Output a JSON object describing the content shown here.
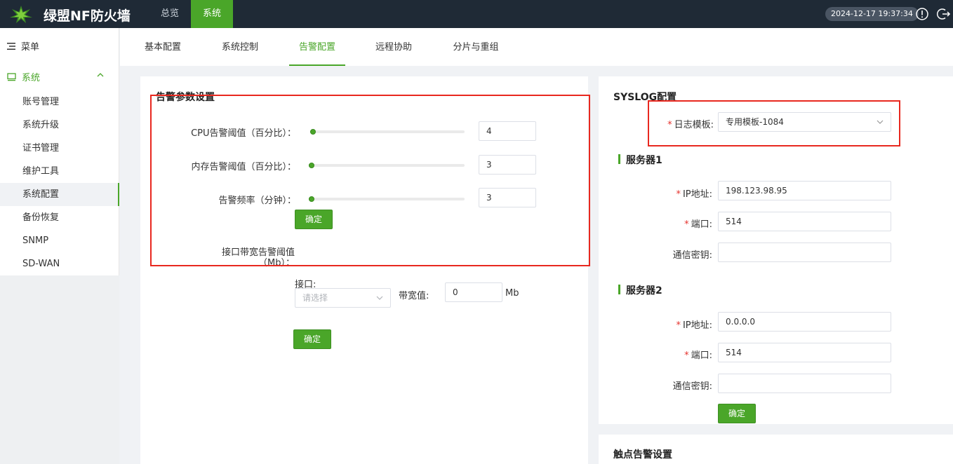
{
  "app": {
    "title": "绿盟NF防火墙",
    "nav": [
      {
        "label": "总览"
      },
      {
        "label": "系统"
      }
    ],
    "datetime": "2024-12-17 19:37:34"
  },
  "sidebar": {
    "menu_label": "菜单",
    "group_label": "系统",
    "items": [
      {
        "label": "账号管理"
      },
      {
        "label": "系统升级"
      },
      {
        "label": "证书管理"
      },
      {
        "label": "维护工具"
      },
      {
        "label": "系统配置"
      },
      {
        "label": "备份恢复"
      },
      {
        "label": "SNMP"
      },
      {
        "label": "SD-WAN"
      }
    ]
  },
  "tabs": [
    {
      "label": "基本配置"
    },
    {
      "label": "系统控制"
    },
    {
      "label": "告警配置"
    },
    {
      "label": "远程协助"
    },
    {
      "label": "分片与重组"
    }
  ],
  "alarm": {
    "title": "告警参数设置",
    "cpu_label": "CPU告警阈值（百分比）：",
    "cpu_value": "4",
    "mem_label": "内存告警阈值（百分比）：",
    "mem_value": "3",
    "freq_label": "告警频率（分钟）：",
    "freq_value": "3",
    "confirm": "确定",
    "bw_label_1": "接口带宽告警阈值",
    "bw_label_2": "（Mb）：",
    "iface_label": "接口:",
    "iface_placeholder": "请选择",
    "bw_value_label": "带宽值:",
    "bw_value": "0",
    "bw_unit": "Mb",
    "confirm2": "确定"
  },
  "syslog": {
    "title": "SYSLOG配置",
    "template_label": "日志模板:",
    "template_value": "专用模板-1084",
    "server1": {
      "title": "服务器1",
      "ip_label": "IP地址:",
      "ip_value": "198.123.98.95",
      "port_label": "端口:",
      "port_value": "514",
      "key_label": "通信密钥:",
      "key_value": ""
    },
    "server2": {
      "title": "服务器2",
      "ip_label": "IP地址:",
      "ip_value": "0.0.0.0",
      "port_label": "端口:",
      "port_value": "514",
      "key_label": "通信密钥:",
      "key_value": ""
    },
    "confirm": "确定"
  },
  "contact": {
    "title": "触点告警设置"
  },
  "colors": {
    "accent": "#4aa629",
    "topbar": "#1f2a36",
    "highlight": "#e8281f"
  }
}
